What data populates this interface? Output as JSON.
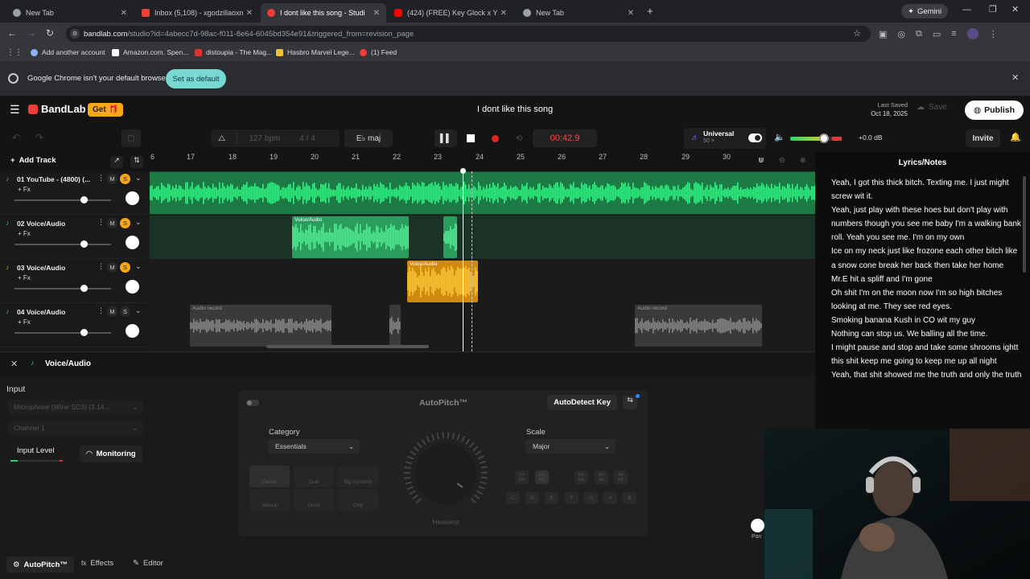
{
  "browser": {
    "tabs": [
      {
        "title": "New Tab",
        "favicon": "chrome-icon",
        "color": "#9aa0a6"
      },
      {
        "title": "Inbox (5,108) - xgodzillaoxmen",
        "favicon": "gmail-icon",
        "color": "#ea4335"
      },
      {
        "title": "I dont like this song - Studi",
        "favicon": "bandlab-icon",
        "color": "#f23c3c"
      },
      {
        "title": "(424) (FREE) Key Glock x Young",
        "favicon": "youtube-icon",
        "color": "#ff0000"
      },
      {
        "title": "New Tab",
        "favicon": "chrome-icon",
        "color": "#9aa0a6"
      }
    ],
    "gemini": "Gemini",
    "url_domain": "bandlab.com",
    "url_path": "/studio?id=4abecc7d-98ac-f011-8e64-6045bd354e91&triggered_from=revision_page",
    "bookmarks": [
      "Add another account",
      "Amazon.com. Spen...",
      "distoupia - The Mag...",
      "Hasbro Marvel Lege...",
      "(1) Feed"
    ],
    "infobar_text": "Google Chrome isn't your default browser",
    "set_default": "Set as default"
  },
  "bandlab": {
    "logo": "BandLab",
    "get_label": "Get",
    "project_title": "I dont like this song",
    "last_saved_label": "Last Saved",
    "last_saved_date": "Oct 18, 2025",
    "save": "Save",
    "publish": "Publish",
    "bpm": "127 bpm",
    "time_sig": "4 / 4",
    "key": "E♭ maj",
    "time": "00:42.9",
    "universal": "Universal",
    "universal_sub": "50 >",
    "db": "+0.0 dB",
    "invite": "Invite",
    "add_track": "Add Track",
    "ruler": [
      "6",
      "17",
      "18",
      "19",
      "20",
      "21",
      "22",
      "23",
      "24",
      "25",
      "26",
      "27",
      "28",
      "29",
      "30"
    ]
  },
  "tracks": [
    {
      "name": "01 YouTube - (4800) (...",
      "fx": "+ Fx",
      "solo_on": true
    },
    {
      "name": "02 Voice/Audio",
      "fx": "+ Fx",
      "solo_on": true
    },
    {
      "name": "03 Voice/Audio",
      "fx": "+ Fx",
      "solo_on": true
    },
    {
      "name": "04 Voice/Audio",
      "fx": "+ Fx",
      "solo_on": false
    }
  ],
  "clips": {
    "voice_audio": "Voice/Audio",
    "audio_record": "Audio record"
  },
  "lyrics": {
    "title": "Lyrics/Notes",
    "lines": [
      "Yeah, I got this thick bitch. Texting me. I just might screw wit it.",
      "Yeah, just play with these hoes but don't play with numbers though you see me baby I'm a walking bank roll. Yeah you see me. I'm on my own",
      "Ice on my neck just like frozone each other bitch like a snow cone break her back then take her home",
      "Mr.E hit a spliff and I'm gone",
      "Oh shit I'm on the moon now I'm so high bitches looking at me. They see red eyes.",
      "Smoking banana Kush in CO wit my guy",
      "Nothing can stop us. We balling all the time.",
      "I might pause and stop and take some shrooms ightt this shit keep me going to keep me up all night",
      " Yeah, that shit showed me the truth and only the truth. Nothing else but yeah"
    ]
  },
  "panel": {
    "track_name": "Voice/Audio",
    "input": "Input",
    "microphone": "Microphone (Wine SC3) (3.14...",
    "channel": "Channel 1",
    "input_level": "Input Level",
    "monitoring": "Monitoring",
    "autopitch_title": "AutoPitch™",
    "autodetect": "AutoDetect Key",
    "category_label": "Category",
    "category_value": "Essentials",
    "scale_label": "Scale",
    "scale_value": "Major",
    "knob_label": "Heaviest",
    "cat_buttons": [
      "Classic",
      "Duet",
      "Big Harmony",
      "Natural",
      "Droid",
      "Chip"
    ],
    "key_row1": [
      "C#\nDb",
      "D#\nEb",
      "F#\nGb",
      "G#\nAb",
      "A#\nBb"
    ],
    "key_row2": [
      "C",
      "D",
      "E",
      "F",
      "G",
      "A",
      "B"
    ],
    "pan": "Pan",
    "bottom_tabs": [
      "AutoPitch™",
      "Effects",
      "Editor"
    ]
  }
}
